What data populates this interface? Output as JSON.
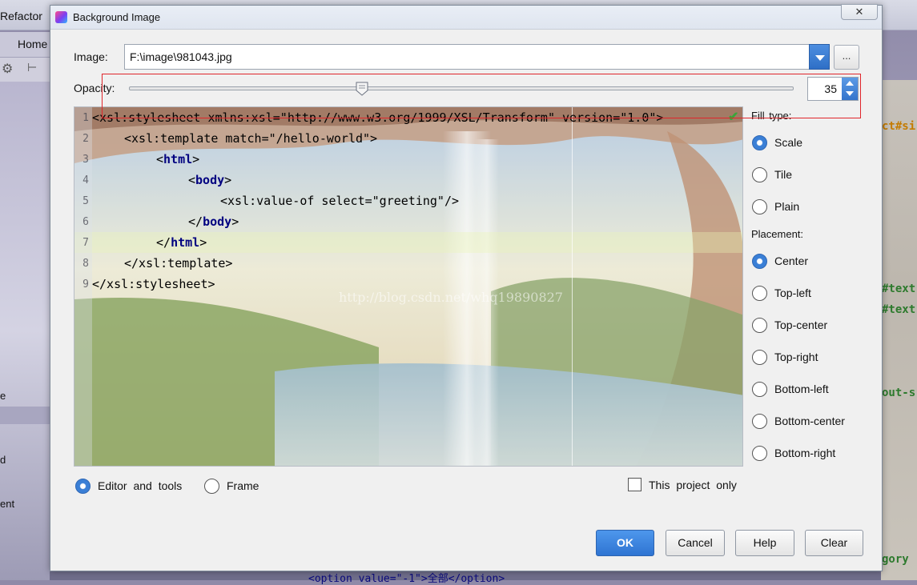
{
  "background": {
    "menu_refactor": "Refactor",
    "home_tab": "Home",
    "side_items": [
      "e",
      "d",
      "ent"
    ],
    "code_fragments": [
      "ct#si",
      "#text",
      "#text",
      "out-s",
      "gory"
    ],
    "bottom_code": "<option value=\"-1\">全部</option>"
  },
  "dialog": {
    "title": "Background Image",
    "close_label": "✕",
    "image_label": "Image:",
    "image_path": "F:\\image\\981043.jpg",
    "browse_label": "...",
    "opacity_label": "Opacity:",
    "opacity_value": 35,
    "opacity_display": "35",
    "fill_type_label": "Fill type:",
    "fill_types": [
      {
        "label": "Scale",
        "selected": true
      },
      {
        "label": "Tile",
        "selected": false
      },
      {
        "label": "Plain",
        "selected": false
      }
    ],
    "placement_label": "Placement:",
    "placements": [
      {
        "label": "Center",
        "selected": true
      },
      {
        "label": "Top-left",
        "selected": false
      },
      {
        "label": "Top-center",
        "selected": false
      },
      {
        "label": "Top-right",
        "selected": false
      },
      {
        "label": "Bottom-left",
        "selected": false
      },
      {
        "label": "Bottom-center",
        "selected": false
      },
      {
        "label": "Bottom-right",
        "selected": false
      }
    ],
    "target_options": [
      {
        "label": "Editor and tools",
        "selected": true
      },
      {
        "label": "Frame",
        "selected": false
      }
    ],
    "project_only_label": "This project only",
    "project_only_checked": false,
    "buttons": {
      "ok": "OK",
      "cancel": "Cancel",
      "help": "Help",
      "clear": "Clear"
    },
    "accent_color": "#3a7fd6"
  },
  "preview": {
    "line_numbers": [
      "1",
      "2",
      "3",
      "4",
      "5",
      "6",
      "7",
      "8",
      "9"
    ],
    "code_lines": [
      {
        "indent": 0,
        "text": "<xsl:stylesheet xmlns:xsl=\"http://www.w3.org/1999/XSL/Transform\" version=\"1.0\">"
      },
      {
        "indent": 1,
        "text": "<xsl:template match=\"/hello-world\">"
      },
      {
        "indent": 2,
        "open": "<",
        "tag": "html",
        "close": ">"
      },
      {
        "indent": 3,
        "open": "<",
        "tag": "body",
        "close": ">"
      },
      {
        "indent": 4,
        "text": "<xsl:value-of select=\"greeting\"/>"
      },
      {
        "indent": 3,
        "open": "</",
        "tag": "body",
        "close": ">"
      },
      {
        "indent": 2,
        "open": "</",
        "tag": "html",
        "close": ">"
      },
      {
        "indent": 1,
        "text": "</xsl:template>"
      },
      {
        "indent": 0,
        "text": "</xsl:stylesheet>"
      }
    ],
    "watermark": "http://blog.csdn.net/whq19890827"
  }
}
